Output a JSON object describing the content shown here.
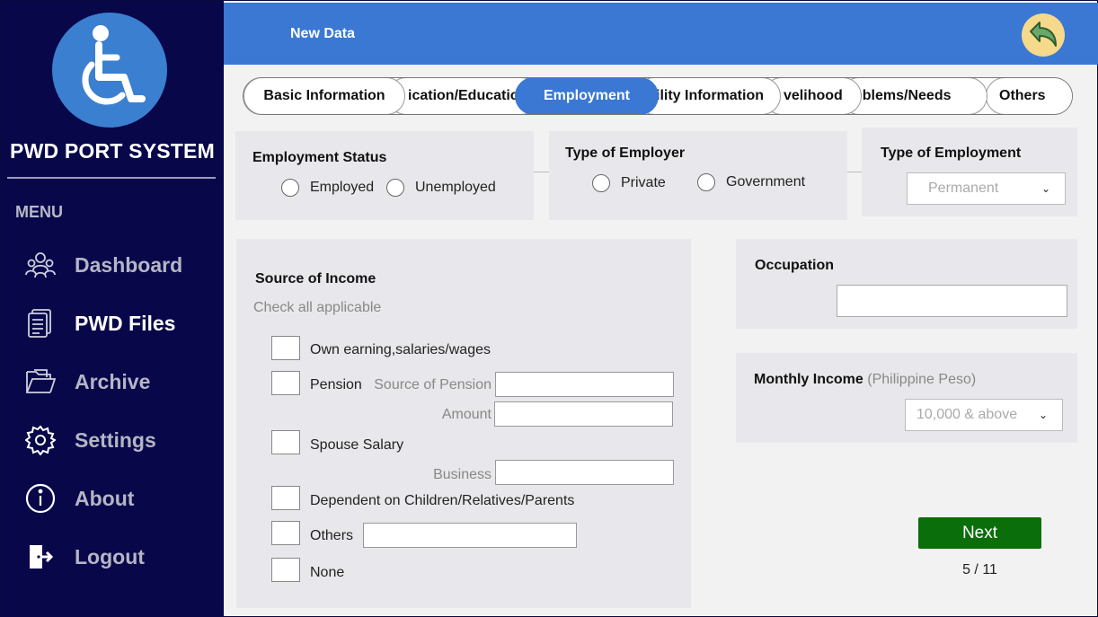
{
  "sidebar": {
    "app_name": "PWD PORT SYSTEM",
    "menu_label": "MENU",
    "items": [
      {
        "label": "Dashboard",
        "icon": "users-icon"
      },
      {
        "label": "PWD Files",
        "icon": "files-icon"
      },
      {
        "label": "Archive",
        "icon": "folder-icon"
      },
      {
        "label": "Settings",
        "icon": "gear-icon"
      },
      {
        "label": "About",
        "icon": "info-icon"
      },
      {
        "label": "Logout",
        "icon": "logout-icon"
      }
    ]
  },
  "header": {
    "title": "New Data"
  },
  "tabs": [
    {
      "label": "Basic Information"
    },
    {
      "label": "ication/Educatio"
    },
    {
      "label": "Employment",
      "active": true
    },
    {
      "label": "ility Information"
    },
    {
      "label": "velihood"
    },
    {
      "label": "oblems/Needs"
    },
    {
      "label": "Others"
    }
  ],
  "employment_status": {
    "title": "Employment Status",
    "options": [
      "Employed",
      "Unemployed"
    ]
  },
  "employer_type": {
    "title": "Type of Employer",
    "options": [
      "Private",
      "Government"
    ]
  },
  "employment_type": {
    "title": "Type of Employment",
    "selected": "Permanent"
  },
  "income_source": {
    "title": "Source of Income",
    "hint": "Check all applicable",
    "options": {
      "own_earning": "Own earning,salaries/wages",
      "pension": "Pension",
      "pension_source_label": "Source of Pension",
      "amount_label": "Amount",
      "spouse_salary": "Spouse Salary",
      "business_label": "Business",
      "dependent": "Dependent on Children/Relatives/Parents",
      "others": "Others",
      "none": "None"
    }
  },
  "occupation": {
    "title": "Occupation"
  },
  "monthly_income": {
    "title": "Monthly Income",
    "unit": "(Philippine Peso)",
    "selected": "10,000 & above"
  },
  "navigation": {
    "next_label": "Next",
    "page": "5 / 11"
  },
  "colors": {
    "sidebar": "#07074a",
    "header": "#3a78d3",
    "active_tab": "#3a78d3",
    "next_button": "#0a6e0a"
  }
}
